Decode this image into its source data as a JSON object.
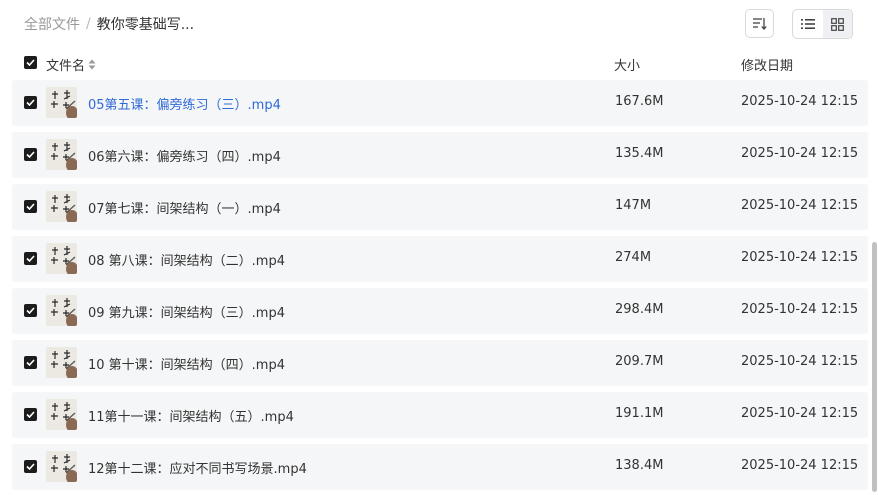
{
  "breadcrumb": {
    "root": "全部文件",
    "separator": "/",
    "current": "教你零基础写..."
  },
  "columns": {
    "name": "文件名",
    "size": "大小",
    "modified": "修改日期"
  },
  "files": [
    {
      "name": "05第五课：偏旁练习（三）.mp4",
      "size": "167.6M",
      "date": "2025-10-24 12:15"
    },
    {
      "name": "06第六课：偏旁练习（四）.mp4",
      "size": "135.4M",
      "date": "2025-10-24 12:15"
    },
    {
      "name": "07第七课：间架结构（一）.mp4",
      "size": "147M",
      "date": "2025-10-24 12:15"
    },
    {
      "name": "08 第八课：间架结构（二）.mp4",
      "size": "274M",
      "date": "2025-10-24 12:15"
    },
    {
      "name": "09 第九课：间架结构（三）.mp4",
      "size": "298.4M",
      "date": "2025-10-24 12:15"
    },
    {
      "name": "10 第十课：间架结构（四）.mp4",
      "size": "209.7M",
      "date": "2025-10-24 12:15"
    },
    {
      "name": "11第十一课：间架结构（五）.mp4",
      "size": "191.1M",
      "date": "2025-10-24 12:15"
    },
    {
      "name": "12第十二课：应对不同书写场景.mp4",
      "size": "138.4M",
      "date": "2025-10-24 12:15"
    }
  ],
  "icons": {
    "sort": "sort-icon",
    "list_view": "list-view-icon",
    "grid_view": "grid-view-icon",
    "checkbox": "checkbox-checked-icon",
    "sort_arrows": "sort-arrows-icon"
  },
  "colors": {
    "link": "#2f6ad8",
    "row_bg": "#f5f6f7",
    "checkbox": "#1c1c1c"
  }
}
